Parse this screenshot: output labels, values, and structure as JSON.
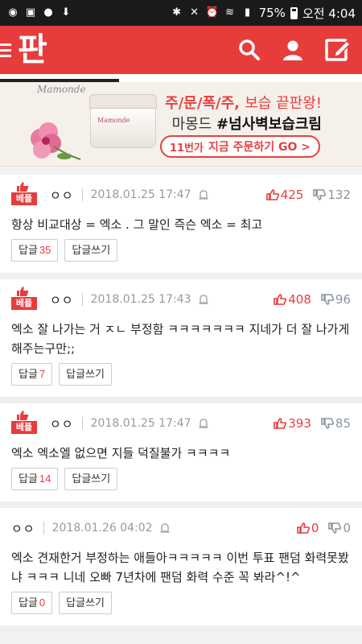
{
  "status_bar": {
    "battery": "75%",
    "time": "오전 4:04"
  },
  "app": {
    "logo": "판",
    "icons": [
      "menu-icon",
      "search-icon",
      "profile-icon",
      "write-icon"
    ]
  },
  "ad": {
    "brand": "Mamonde",
    "jar_label": "Mamonde",
    "headline_a": "주",
    "headline_b": "문",
    "headline_c": "폭",
    "headline_d": "주",
    "headline_rest": "보습 끝판왕!",
    "sub_prefix": "마몽드",
    "sub_tag": "#넘사벽보습크림",
    "cta_11": "11번가",
    "cta_text": "지금 주문하기 GO >"
  },
  "comments": [
    {
      "best": true,
      "best_label": "베플",
      "author": "ㅇㅇ",
      "date": "2018.01.25 17:47",
      "up": "425",
      "down": "132",
      "text": "항상 비교대상 = 엑소 . 그 말인 즉슨 엑소 = 최고",
      "reply_label": "답글",
      "reply_count": "35",
      "write_reply": "답글쓰기"
    },
    {
      "best": true,
      "best_label": "베플",
      "author": "ㅇㅇ",
      "date": "2018.01.25 17:43",
      "up": "408",
      "down": "96",
      "text": "엑소 잘 나가는 거 ㅈㄴ 부정함 ㅋㅋㅋㅋㅋㅋㅋ 지네가 더 잘 나가게 해주는구만;;",
      "reply_label": "답글",
      "reply_count": "7",
      "write_reply": "답글쓰기"
    },
    {
      "best": true,
      "best_label": "베플",
      "author": "ㅇㅇ",
      "date": "2018.01.25 17:47",
      "up": "393",
      "down": "85",
      "text": "엑소 엑소엘 없으면 지들 덕질불가 ㅋㅋㅋㅋ",
      "reply_label": "답글",
      "reply_count": "14",
      "write_reply": "답글쓰기"
    },
    {
      "best": false,
      "best_label": "",
      "author": "ㅇㅇ",
      "date": "2018.01.26 04:02",
      "up": "0",
      "down": "0",
      "text": "엑소 견재한거 부정하는 애들아ㅋㅋㅋㅋㅋ 이번 투표 팬덤 화력못봤냐 ㅋㅋㅋ 니네 오빠 7년차에 팬덤 화력 수준 꼭 봐라^!^",
      "reply_label": "답글",
      "reply_count": "0",
      "write_reply": "답글쓰기"
    }
  ],
  "colors": {
    "brand_red": "#e73c3c",
    "down_gray": "#8a94a0"
  }
}
